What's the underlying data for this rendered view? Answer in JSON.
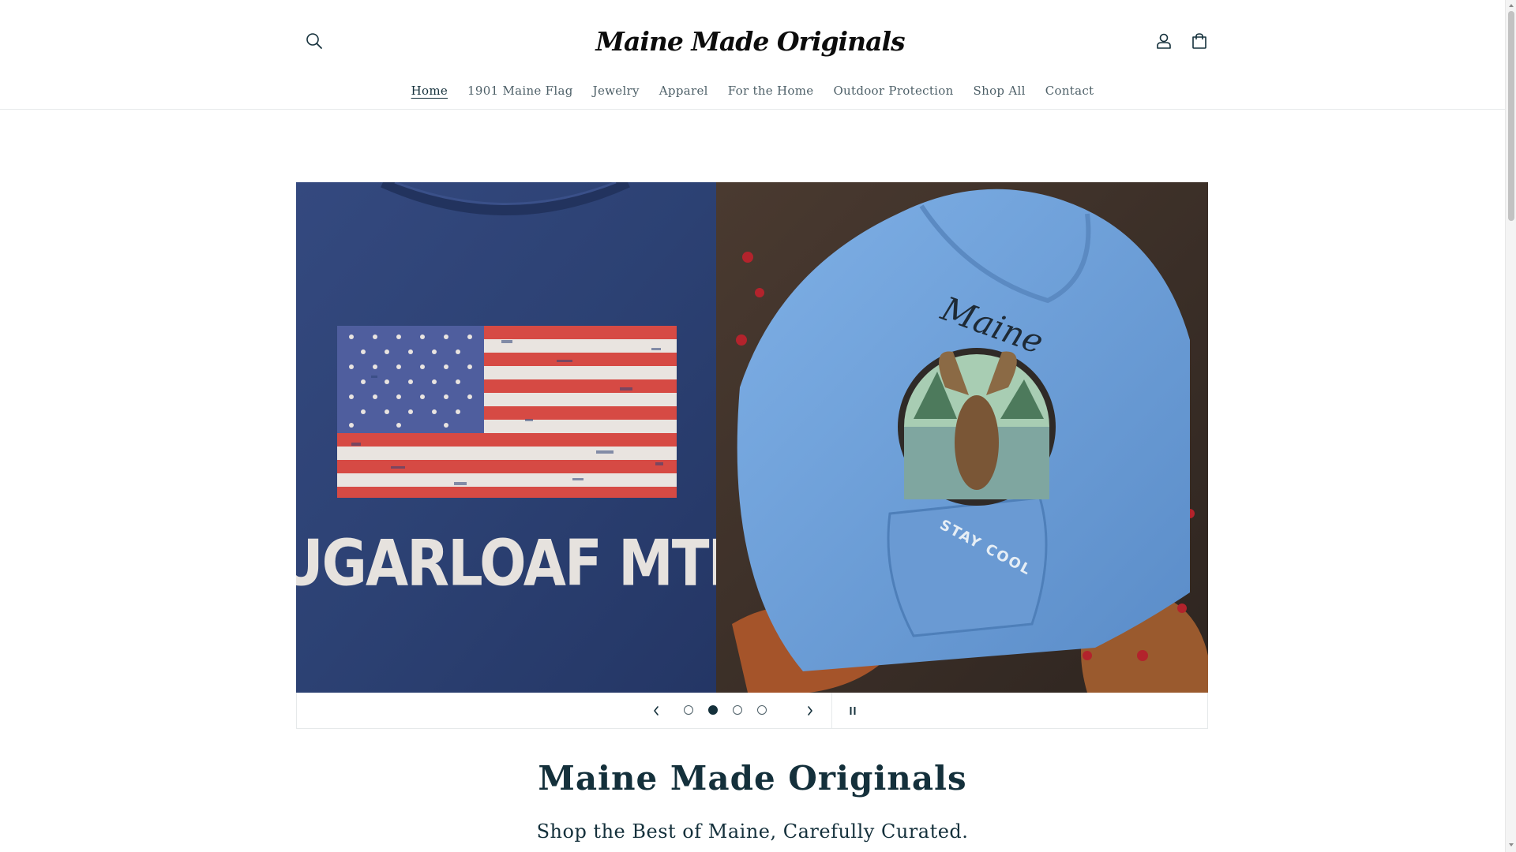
{
  "header": {
    "logo_text": "Maine Made Originals",
    "search_icon": "search-icon",
    "account_icon": "user-icon",
    "cart_icon": "cart-icon"
  },
  "nav": {
    "items": [
      {
        "label": "Home",
        "active": true
      },
      {
        "label": "1901 Maine Flag",
        "active": false
      },
      {
        "label": "Jewelry",
        "active": false
      },
      {
        "label": "Apparel",
        "active": false
      },
      {
        "label": "For the Home",
        "active": false
      },
      {
        "label": "Outdoor Protection",
        "active": false
      },
      {
        "label": "Shop All",
        "active": false
      },
      {
        "label": "Contact",
        "active": false
      }
    ]
  },
  "slideshow": {
    "left_image": {
      "shirt_text": "SUGARLOAF MTN.",
      "shirt_color": "#2e4477"
    },
    "right_image": {
      "hoodie_script": "Maine",
      "hoodie_badge": "STAY COOL",
      "hoodie_color": "#6f9fd8"
    },
    "slide_count": 4,
    "active_slide": 2,
    "prev_icon": "chevron-left-icon",
    "next_icon": "chevron-right-icon",
    "pause_icon": "pause-icon"
  },
  "hero": {
    "title": "Maine Made Originals",
    "subtitle": "Shop the Best of Maine, Carefully Curated."
  },
  "colors": {
    "text": "#14303b",
    "nav_text": "#4e6068",
    "border": "#e6e9ea"
  }
}
